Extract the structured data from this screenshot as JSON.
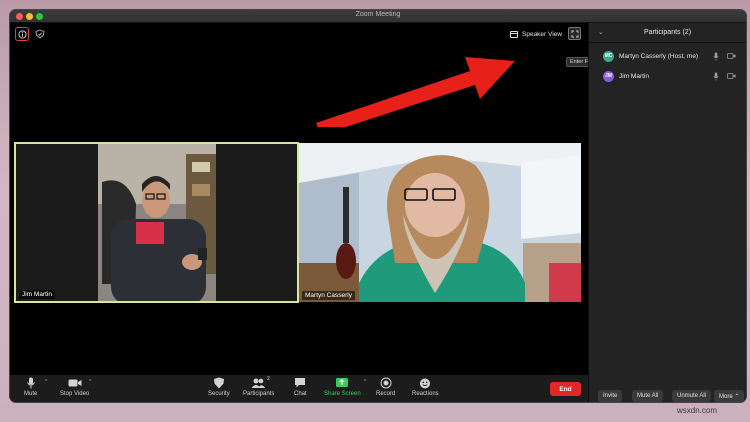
{
  "window": {
    "title": "Zoom Meeting"
  },
  "stage": {
    "speaker_view_label": "Speaker View",
    "fullscreen_tooltip": "Enter Full Screen"
  },
  "videos": [
    {
      "name": "Jim Martin"
    },
    {
      "name": "Martyn Casserly"
    }
  ],
  "toolbar": {
    "mute": "Mute",
    "stop_video": "Stop Video",
    "security": "Security",
    "participants": "Participants",
    "participants_count": "2",
    "chat": "Chat",
    "share_screen": "Share Screen",
    "record": "Record",
    "reactions": "Reactions",
    "end": "End"
  },
  "participants_panel": {
    "title": "Participants (2)",
    "list": [
      {
        "initials": "MC",
        "name": "Martyn Casserly (Host, me)",
        "color": "#3aa88a"
      },
      {
        "initials": "JM",
        "name": "Jim Martin",
        "color": "#8a5bd6"
      }
    ],
    "invite": "Invite",
    "mute_all": "Mute All",
    "unmute_all": "Unmute All",
    "more": "More ⌃"
  },
  "colors": {
    "end_red": "#e02828",
    "share_green": "#3ccc5c",
    "annotation_arrow": "#e8201a"
  },
  "watermark": "wsxdn.com"
}
